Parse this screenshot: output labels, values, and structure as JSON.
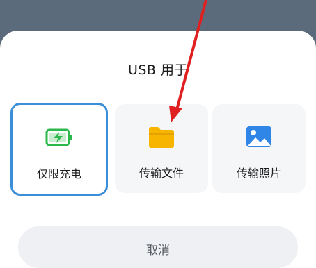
{
  "dialog": {
    "title": "USB 用于",
    "options": [
      {
        "label": "仅限充电",
        "icon": "battery-charging-icon",
        "selected": true
      },
      {
        "label": "传输文件",
        "icon": "folder-icon",
        "selected": false
      },
      {
        "label": "传输照片",
        "icon": "image-icon",
        "selected": false
      }
    ],
    "cancel_label": "取消"
  },
  "colors": {
    "selected_border": "#3a8fd8",
    "battery_green": "#2db84d",
    "folder_yellow": "#f7b500",
    "photo_blue": "#2f86e6",
    "annotation_red": "#e02020"
  }
}
